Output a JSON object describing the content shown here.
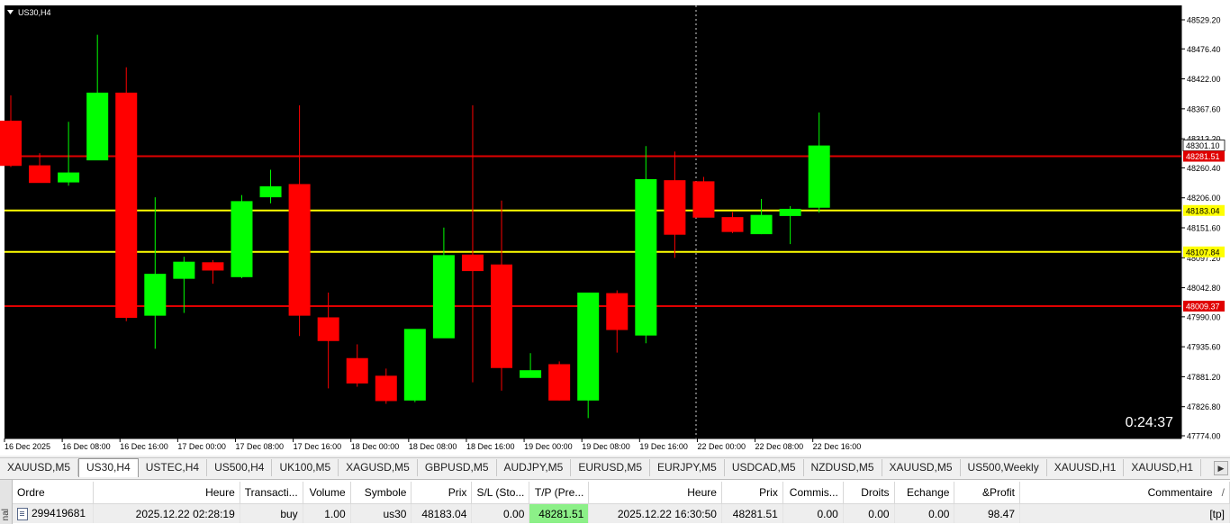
{
  "chart_data": {
    "type": "candlestick",
    "symbol_label": "US30,H4",
    "countdown": "0:24:37",
    "y_ticks": [
      "48529.20",
      "48476.40",
      "48422.00",
      "48367.60",
      "48313.20",
      "48260.40",
      "48206.00",
      "48151.60",
      "48097.20",
      "48042.80",
      "47990.00",
      "47935.60",
      "47881.20",
      "47826.80",
      "47774.00"
    ],
    "x_ticks": [
      "16 Dec 2025",
      "16 Dec 08:00",
      "16 Dec 16:00",
      "17 Dec 00:00",
      "17 Dec 08:00",
      "17 Dec 16:00",
      "18 Dec 00:00",
      "18 Dec 08:00",
      "18 Dec 16:00",
      "19 Dec 00:00",
      "19 Dec 08:00",
      "19 Dec 16:00",
      "22 Dec 00:00",
      "22 Dec 08:00",
      "22 Dec 16:00"
    ],
    "price_lines": [
      {
        "price": 48281.51,
        "label": "48281.51",
        "color": "#e00000"
      },
      {
        "price": 48183.04,
        "label": "48183.04",
        "color": "#ffff00"
      },
      {
        "price": 48107.84,
        "label": "48107.84",
        "color": "#ffff00"
      },
      {
        "price": 48009.37,
        "label": "48009.37",
        "color": "#e00000"
      }
    ],
    "current_price": {
      "price": 48301.1,
      "label": "48301.10"
    },
    "candles": [
      {
        "o": 48346,
        "h": 48392,
        "l": 48262,
        "c": 48264
      },
      {
        "o": 48265,
        "h": 48287,
        "l": 48250,
        "c": 48233
      },
      {
        "o": 48234,
        "h": 48344,
        "l": 48228,
        "c": 48252
      },
      {
        "o": 48274,
        "h": 48502,
        "l": 48278,
        "c": 48397
      },
      {
        "o": 48397,
        "h": 48443,
        "l": 47982,
        "c": 47988
      },
      {
        "o": 47992,
        "h": 48207,
        "l": 47932,
        "c": 48068
      },
      {
        "o": 48059,
        "h": 48099,
        "l": 47997,
        "c": 48090
      },
      {
        "o": 48089,
        "h": 48093,
        "l": 48050,
        "c": 48074
      },
      {
        "o": 48062,
        "h": 48211,
        "l": 48060,
        "c": 48200
      },
      {
        "o": 48207,
        "h": 48257,
        "l": 48196,
        "c": 48227
      },
      {
        "o": 48231,
        "h": 48374,
        "l": 47955,
        "c": 47992
      },
      {
        "o": 47989,
        "h": 48034,
        "l": 47860,
        "c": 47946
      },
      {
        "o": 47915,
        "h": 47940,
        "l": 47863,
        "c": 47869
      },
      {
        "o": 47883,
        "h": 47896,
        "l": 47832,
        "c": 47837
      },
      {
        "o": 47838,
        "h": 47952,
        "l": 47835,
        "c": 47968
      },
      {
        "o": 47951,
        "h": 48152,
        "l": 47956,
        "c": 48102
      },
      {
        "o": 48103,
        "h": 48374,
        "l": 47871,
        "c": 48073
      },
      {
        "o": 48085,
        "h": 48201,
        "l": 47856,
        "c": 47897
      },
      {
        "o": 47879,
        "h": 47924,
        "l": 47881,
        "c": 47893
      },
      {
        "o": 47904,
        "h": 47909,
        "l": 47838,
        "c": 47838
      },
      {
        "o": 47838,
        "h": 48033,
        "l": 47806,
        "c": 48034
      },
      {
        "o": 48033,
        "h": 48038,
        "l": 47925,
        "c": 47966
      },
      {
        "o": 47956,
        "h": 48300,
        "l": 47942,
        "c": 48240
      },
      {
        "o": 48238,
        "h": 48290,
        "l": 48097,
        "c": 48139
      },
      {
        "o": 48236,
        "h": 48244,
        "l": 48178,
        "c": 48170
      },
      {
        "o": 48171,
        "h": 48180,
        "l": 48142,
        "c": 48144
      },
      {
        "o": 48140,
        "h": 48204,
        "l": 48140,
        "c": 48175
      },
      {
        "o": 48173,
        "h": 48191,
        "l": 48122,
        "c": 48186
      },
      {
        "o": 48188,
        "h": 48361,
        "l": 48179,
        "c": 48301
      }
    ]
  },
  "tabs": [
    "XAUUSD,M5",
    "US30,H4",
    "USTEC,H4",
    "US500,H4",
    "UK100,M5",
    "XAGUSD,M5",
    "GBPUSD,M5",
    "AUDJPY,M5",
    "EURUSD,M5",
    "EURJPY,M5",
    "USDCAD,M5",
    "NZDUSD,M5",
    "XAUUSD,M5",
    "US500,Weekly",
    "XAUUSD,H1",
    "XAUUSD,H1"
  ],
  "active_tab": 1,
  "terminal": {
    "side_label": "nal",
    "columns": [
      "Ordre",
      "Heure",
      "Transacti...",
      "Volume",
      "Symbole",
      "Prix",
      "S/L (Sto...",
      "T/P (Pre...",
      "Heure",
      "Prix",
      "Commis...",
      "Droits",
      "Echange",
      "&Profit",
      "Commentaire"
    ],
    "sort_arrow": "/",
    "row": [
      "299419681",
      "2025.12.22 02:28:19",
      "buy",
      "1.00",
      "us30",
      "48183.04",
      "0.00",
      "48281.51",
      "2025.12.22 16:30:50",
      "48281.51",
      "0.00",
      "0.00",
      "0.00",
      "98.47",
      "[tp]"
    ]
  }
}
